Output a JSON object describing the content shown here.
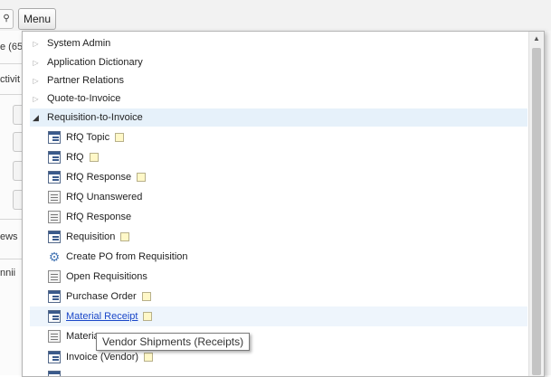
{
  "toolbar": {
    "search_icon": "search-icon",
    "menu_label": "Menu"
  },
  "background": {
    "fragments": [
      "e (65",
      "ctivit",
      "ews",
      "nnii"
    ]
  },
  "menu": {
    "folders": [
      {
        "label": "System Admin",
        "expanded": false
      },
      {
        "label": "Application Dictionary",
        "expanded": false
      },
      {
        "label": "Partner Relations",
        "expanded": false
      },
      {
        "label": "Quote-to-Invoice",
        "expanded": false
      },
      {
        "label": "Requisition-to-Invoice",
        "expanded": true
      }
    ],
    "items": [
      {
        "label": "RfQ Topic",
        "icon": "window-icon",
        "favorite": true
      },
      {
        "label": "RfQ",
        "icon": "window-icon",
        "favorite": true
      },
      {
        "label": "RfQ Response",
        "icon": "window-icon",
        "favorite": true
      },
      {
        "label": "RfQ Unanswered",
        "icon": "report-icon",
        "favorite": false
      },
      {
        "label": "RfQ Response",
        "icon": "report-icon",
        "favorite": false
      },
      {
        "label": "Requisition",
        "icon": "window-icon",
        "favorite": true
      },
      {
        "label": "Create PO from Requisition",
        "icon": "process-icon",
        "favorite": false
      },
      {
        "label": "Open Requisitions",
        "icon": "report-icon",
        "favorite": false
      },
      {
        "label": "Purchase Order",
        "icon": "window-icon",
        "favorite": true
      },
      {
        "label": "Material Receipt",
        "icon": "window-icon",
        "favorite": true
      },
      {
        "label": "Materia",
        "icon": "report-icon",
        "favorite": false
      },
      {
        "label": "Invoice (Vendor)",
        "icon": "window-icon",
        "favorite": true
      }
    ]
  },
  "tooltip": {
    "text": "Vendor Shipments (Receipts)"
  },
  "colors": {
    "selected_row": "#e6f1fa",
    "link": "#1a47c8",
    "favorite_marker": "#fff8c8"
  }
}
